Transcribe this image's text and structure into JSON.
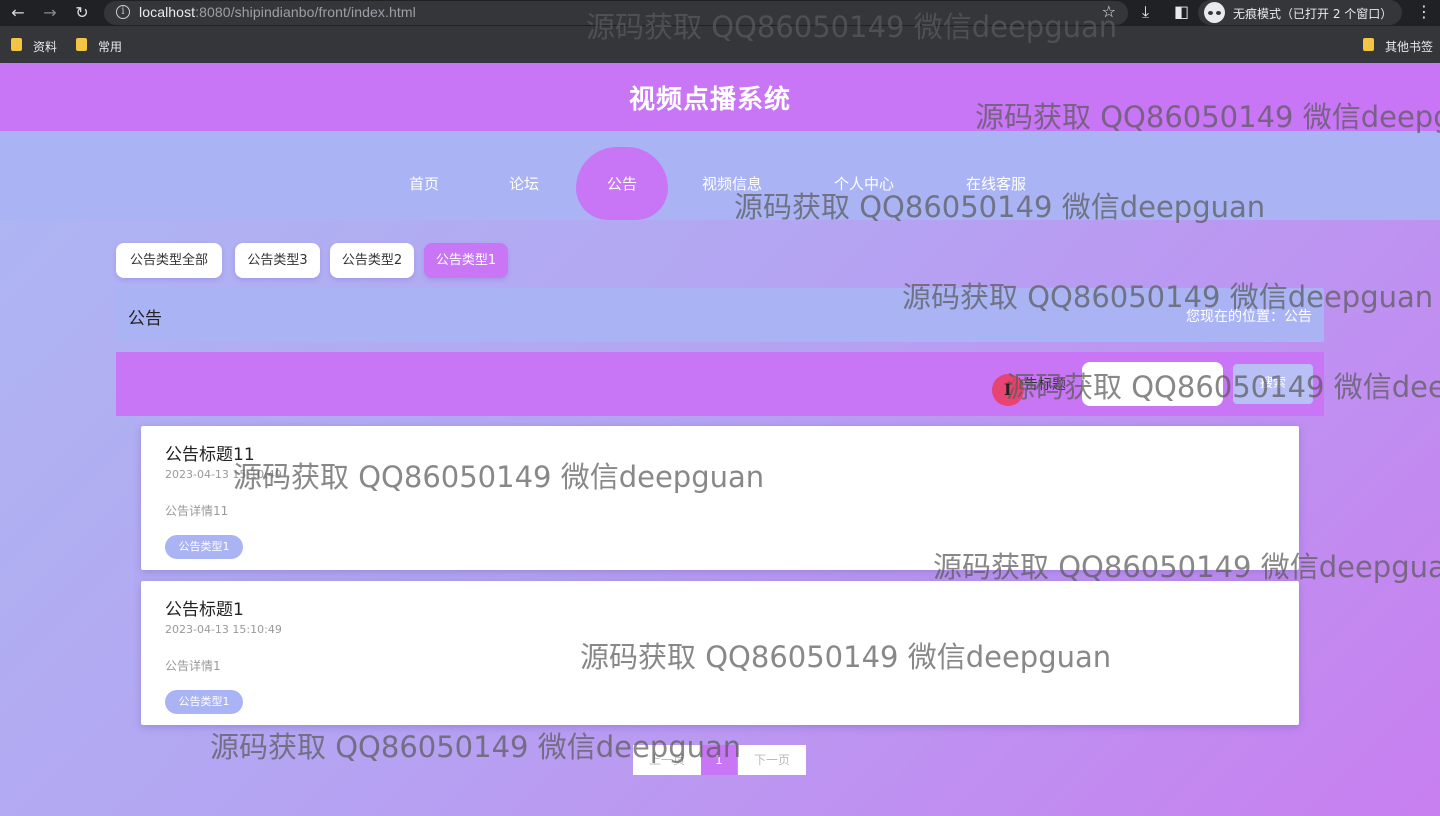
{
  "browser": {
    "url_host": "localhost",
    "url_rest": ":8080/shipindianbo/front/index.html",
    "incognito_label": "无痕模式（已打开 2 个窗口）",
    "bookmarks": [
      "资料",
      "常用"
    ],
    "other_bookmarks": "其他书签"
  },
  "site": {
    "title": "视频点播系统"
  },
  "nav": {
    "items": [
      "首页",
      "论坛",
      "公告",
      "视频信息",
      "个人中心",
      "在线客服"
    ],
    "active": "公告"
  },
  "filters": [
    "公告类型全部",
    "公告类型3",
    "公告类型2",
    "公告类型1"
  ],
  "crumb": {
    "title": "公告",
    "position": "您现在的位置：公告"
  },
  "search": {
    "label": "公告标题",
    "value": "",
    "button": "搜索"
  },
  "notices": [
    {
      "title": "公告标题11",
      "time": "2023-04-13 15:10:49",
      "desc": "公告详情11",
      "tag": "公告类型1"
    },
    {
      "title": "公告标题1",
      "time": "2023-04-13 15:10:49",
      "desc": "公告详情1",
      "tag": "公告类型1"
    }
  ],
  "pager": {
    "prev": "上一页",
    "current": "1",
    "next": "下一页"
  },
  "watermark": "源码获取 QQ86050149 微信deepguan",
  "colors": {
    "primary": "#c875f6",
    "secondary": "#aab4f4"
  }
}
